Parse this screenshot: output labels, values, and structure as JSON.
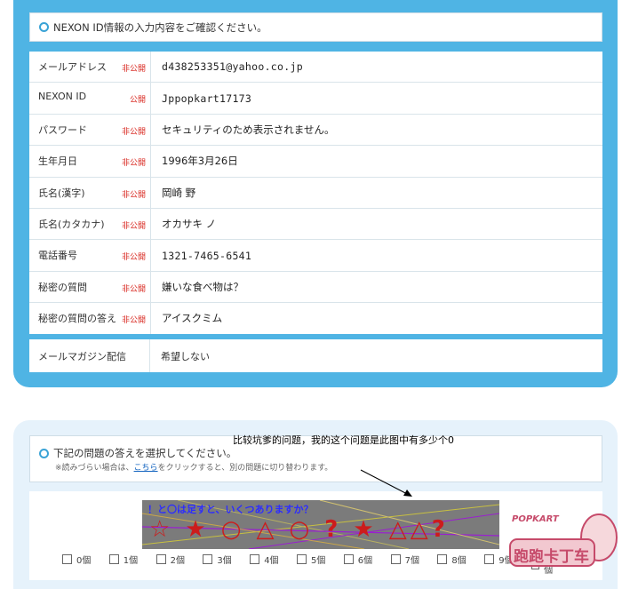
{
  "confirm": {
    "header": "NEXON ID情報の入力内容をご確認ください。",
    "rows": [
      {
        "label": "メールアドレス",
        "badge": "非公開",
        "value": "d438253351@yahoo.co.jp",
        "mono": true
      },
      {
        "label": "NEXON ID",
        "badge": "公開",
        "value": "Jppopkart17173",
        "mono": true
      },
      {
        "label": "パスワード",
        "badge": "非公開",
        "value": "セキュリティのため表示されません。",
        "mono": false
      },
      {
        "label": "生年月日",
        "badge": "非公開",
        "value": "1996年3月26日",
        "mono": false
      },
      {
        "label": "氏名(漢字)",
        "badge": "非公開",
        "value": "岡崎 野",
        "mono": false
      },
      {
        "label": "氏名(カタカナ)",
        "badge": "非公開",
        "value": "オカサキ ノ",
        "mono": false
      },
      {
        "label": "電話番号",
        "badge": "非公開",
        "value": "1321-7465-6541",
        "mono": true
      },
      {
        "label": "秘密の質問",
        "badge": "非公開",
        "value": "嫌いな食べ物は？",
        "mono": false
      },
      {
        "label": "秘密の質問の答え",
        "badge": "非公開",
        "value": "アイスクミム",
        "mono": false
      }
    ],
    "magazine": {
      "label": "メールマガジン配信",
      "value": "希望しない"
    }
  },
  "quiz": {
    "header": "下記の問題の答えを選択してください。",
    "hint_prefix": "※読みづらい場合は、",
    "hint_link": "こちら",
    "hint_suffix": "をクリックすると、別の問題に切り替わります。",
    "annotation": "比较坑爹的问题，我的这个问题是此图中有多少个0",
    "captcha_question": "！と〇は足すと、いくつありますか？",
    "captcha_symbols": "☆ ★ ○ △ ○ ? ★ △△?",
    "options": [
      "0個",
      "1個",
      "2個",
      "3個",
      "4個",
      "5個",
      "6個",
      "7個",
      "8個",
      "9個",
      "10個"
    ]
  },
  "watermark": {
    "line1": "POPKART",
    "line2": "跑跑卡丁车"
  }
}
